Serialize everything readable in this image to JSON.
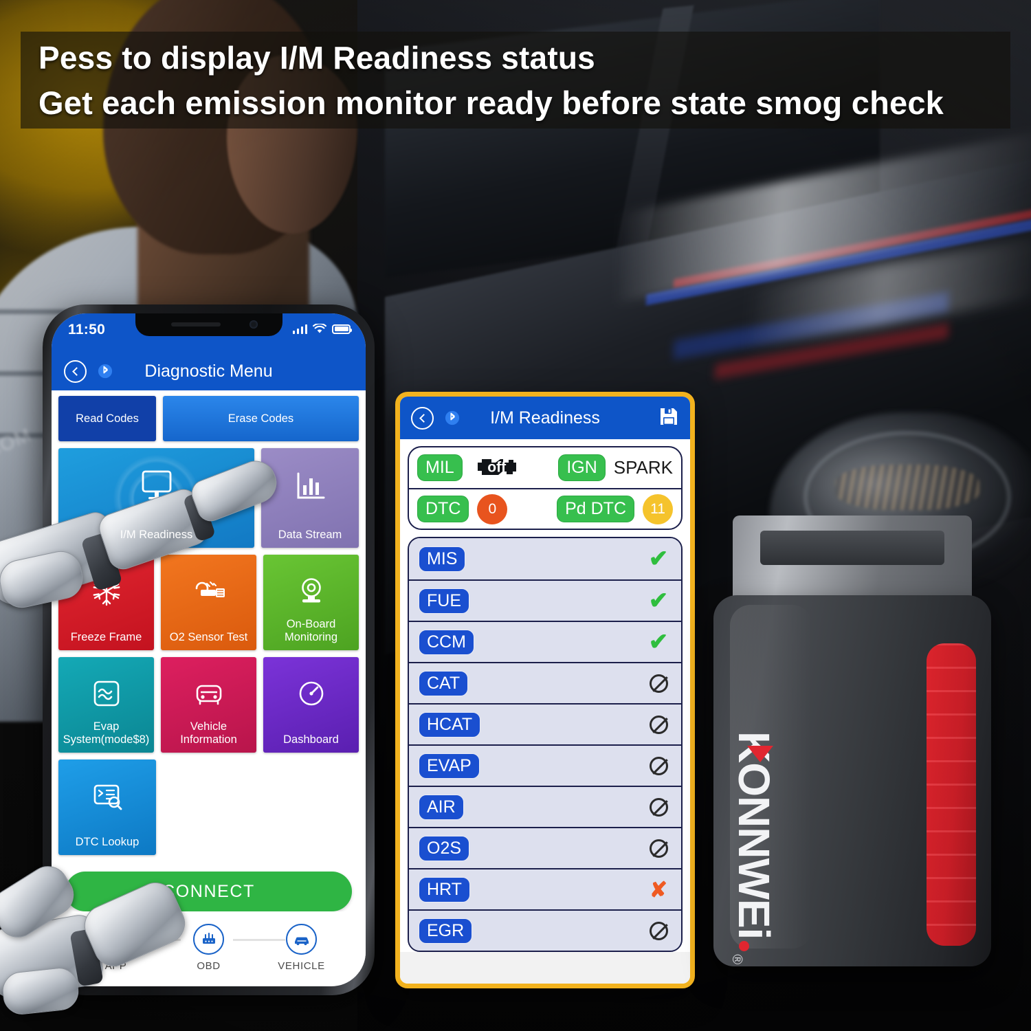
{
  "banner": {
    "line1": "Pess to display I/M Readiness status",
    "line2": "Get each emission monitor ready before state smog check"
  },
  "phone": {
    "status_bar": {
      "time": "11:50",
      "signal_icon": "signal-bars-icon",
      "wifi_icon": "wifi-icon",
      "battery_icon": "battery-icon"
    },
    "nav": {
      "title": "Diagnostic Menu",
      "back_icon": "back-chevron-icon",
      "bluetooth_icon": "bluetooth-icon"
    },
    "tiles": [
      {
        "label": "Read Codes",
        "icon": "none",
        "color": "#1140a8"
      },
      {
        "label": "Erase Codes",
        "icon": "none",
        "color": "#1f72dd"
      },
      {
        "label": "I/M Readiness",
        "icon": "monitor-icon",
        "color": "#1792d6"
      },
      {
        "label": "Data Stream",
        "icon": "bar-chart-icon",
        "color": "#8c7cbb"
      },
      {
        "label": "Freeze Frame",
        "icon": "snowflake-icon",
        "color": "#d81f2a"
      },
      {
        "label": "O2 Sensor Test",
        "icon": "oxygen-sensor-icon",
        "color": "#ec6816"
      },
      {
        "label": "On-Board Monitoring",
        "icon": "camera-icon",
        "color": "#5fb92d"
      },
      {
        "label": "Evap System(mode$8)",
        "icon": "wave-box-icon",
        "color": "#0f9aa8"
      },
      {
        "label": "Vehicle Information",
        "icon": "car-front-icon",
        "color": "#cc1a56"
      },
      {
        "label": "Dashboard",
        "icon": "gauge-icon",
        "color": "#6a2bc4"
      },
      {
        "label": "DTC Lookup",
        "icon": "code-search-icon",
        "color": "#1a8fdc"
      }
    ],
    "connect_button": "CONNECT",
    "steps": [
      {
        "label": "APP",
        "icon": "app-icon"
      },
      {
        "label": "OBD",
        "icon": "obd-adapter-icon"
      },
      {
        "label": "VEHICLE",
        "icon": "car-icon"
      }
    ]
  },
  "im_readiness": {
    "nav": {
      "title": "I/M Readiness",
      "back_icon": "back-chevron-icon",
      "bluetooth_icon": "bluetooth-icon",
      "save_icon": "save-floppy-icon"
    },
    "summary": [
      {
        "label": "MIL",
        "value": "off",
        "value_kind": "engine-icon",
        "label_color": "#37bf4e"
      },
      {
        "label": "IGN",
        "value": "SPARK",
        "value_kind": "text",
        "label_color": "#37bf4e"
      },
      {
        "label": "DTC",
        "value": "0",
        "value_kind": "dot",
        "label_color": "#37bf4e",
        "dot_color": "#e8541e"
      },
      {
        "label": "Pd DTC",
        "value": "11",
        "value_kind": "dot",
        "label_color": "#37bf4e",
        "dot_color": "#f5c32c"
      }
    ],
    "monitors": [
      {
        "name": "MIS",
        "status": "ready"
      },
      {
        "name": "FUE",
        "status": "ready"
      },
      {
        "name": "CCM",
        "status": "ready"
      },
      {
        "name": "CAT",
        "status": "na"
      },
      {
        "name": "HCAT",
        "status": "na"
      },
      {
        "name": "EVAP",
        "status": "na"
      },
      {
        "name": "AIR",
        "status": "na"
      },
      {
        "name": "O2S",
        "status": "na"
      },
      {
        "name": "HRT",
        "status": "not-ready"
      },
      {
        "name": "EGR",
        "status": "na"
      }
    ],
    "status_glyphs": {
      "ready": "✔",
      "not-ready": "✘",
      "na": "na-circle-icon"
    }
  },
  "device": {
    "brand_k": "K",
    "brand_rest": "ONNWE",
    "brand_i": "i",
    "brand_mark": "®"
  },
  "background": {
    "shirt_text": ".COM"
  },
  "colors": {
    "nav_blue": "#0e55c8",
    "panel_border_yellow": "#f2b21e",
    "green": "#37bf4e",
    "tag_blue": "#1a4fd0",
    "orange": "#e8541e",
    "yellow": "#f5c32c",
    "connect_green": "#2fb544",
    "device_red": "#e02630"
  }
}
